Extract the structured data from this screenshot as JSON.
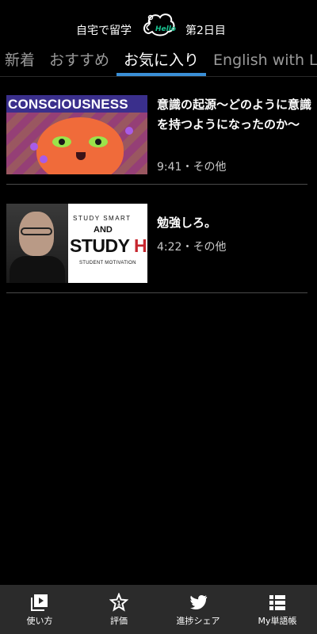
{
  "header": {
    "left_text": "自宅で留学",
    "logo_text": "Hello",
    "right_text": "第2日目"
  },
  "tabs": [
    {
      "label": "新着",
      "active": false
    },
    {
      "label": "おすすめ",
      "active": false
    },
    {
      "label": "お気に入り",
      "active": true
    },
    {
      "label": "English with L",
      "active": false
    }
  ],
  "videos": [
    {
      "thumbnail_caption": "CONSCIOUSNESS",
      "title": "意識の起源～どのように意識を持つようになったのか～",
      "meta": "9:41・その他"
    },
    {
      "thumbnail_line1": "STUDY SMART",
      "thumbnail_line2": "AND",
      "thumbnail_line3a": "STUDY ",
      "thumbnail_line3b": "HARD",
      "thumbnail_line4": "STUDENT MOTIVATION",
      "title": "勉強しろ。",
      "meta": "4:22・その他"
    }
  ],
  "bottom_nav": [
    {
      "label": "使い方",
      "icon": "play-guide-icon"
    },
    {
      "label": "評価",
      "icon": "star-rating-icon"
    },
    {
      "label": "進捗シェア",
      "icon": "twitter-icon"
    },
    {
      "label": "My単語帳",
      "icon": "list-icon"
    }
  ],
  "colors": {
    "accent": "#3a8fd6",
    "logo_green": "#19c18f",
    "background": "#000000",
    "nav_background": "#2b2b2b"
  }
}
